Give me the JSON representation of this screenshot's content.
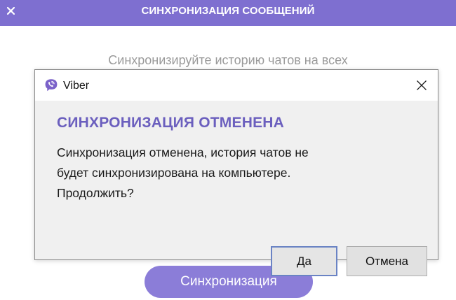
{
  "app": {
    "header_title": "СИНХРОНИЗАЦИЯ СООБЩЕНИЙ",
    "description": "Синхронизируйте историю чатов на всех",
    "sync_button_label": "Синхронизация",
    "accent_color": "#7e6fd0"
  },
  "dialog": {
    "window_title": "Viber",
    "heading": "СИНХРОНИЗАЦИЯ ОТМЕНЕНА",
    "message_lines": [
      "Синхронизация отменена, история чатов не",
      "будет синхронизирована на компьютере.",
      "Продолжить?"
    ],
    "yes_label": "Да",
    "cancel_label": "Отмена",
    "heading_color": "#6b5fbe"
  },
  "icons": {
    "header_close": "close-icon",
    "app_logo": "viber-logo-icon",
    "dialog_close": "close-icon"
  }
}
